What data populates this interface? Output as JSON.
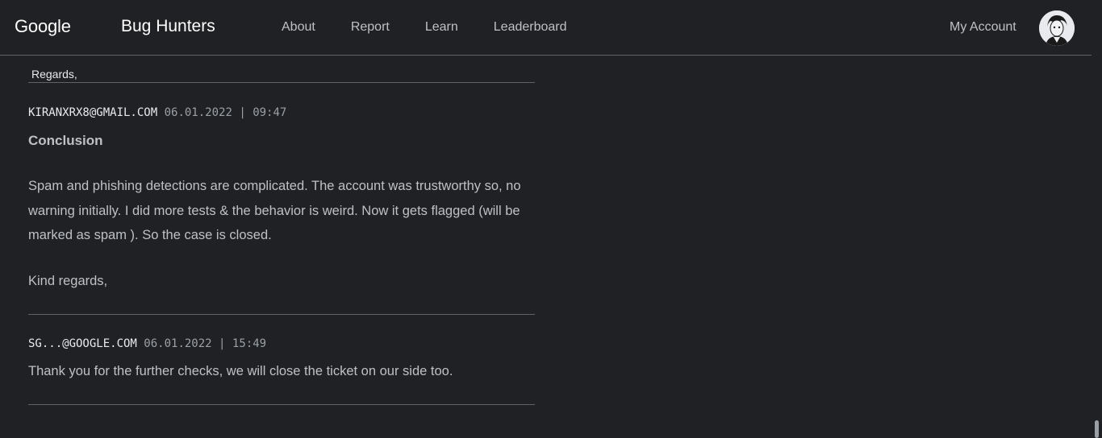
{
  "header": {
    "brand_google": "Google",
    "brand_name": "Bug Hunters",
    "nav": [
      "About",
      "Report",
      "Learn",
      "Leaderboard"
    ],
    "account_label": "My Account"
  },
  "thread": {
    "previous_tail": "Regards,",
    "comments": [
      {
        "author": "KIRANXRX8@GMAIL.COM",
        "date": "06.01.2022",
        "separator": "|",
        "time": "09:47",
        "heading": "Conclusion",
        "body": "Spam and phishing detections are complicated. The account was trustworthy so, no warning initially. I did more tests & the behavior is weird. Now it gets flagged (will be marked as spam ). So the case is closed.",
        "closing": "Kind regards,"
      },
      {
        "author": "SG...@GOOGLE.COM",
        "date": "06.01.2022",
        "separator": "|",
        "time": "15:49",
        "body": "Thank you for the further checks, we will close the ticket on our side too."
      }
    ]
  },
  "colors": {
    "background": "#202124",
    "text": "#bdc1c6",
    "divider": "#5f6368"
  },
  "icons": {
    "avatar": "user-avatar-icon"
  }
}
